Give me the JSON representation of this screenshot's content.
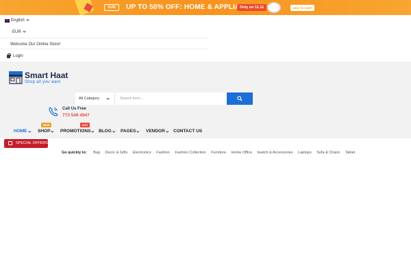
{
  "promo": {
    "logo_badge": "OUR",
    "headline": "UP TO 50% OFF: HOME & APPLIANCES",
    "badge": "Only on 11.11",
    "cta": "ADD TO CART"
  },
  "topbar": {
    "language": "English",
    "currency": "EUR",
    "welcome": "Welcome Our Online Store!",
    "login": "Login"
  },
  "brand": {
    "name": "Smart Haat",
    "tagline": "Shop all you want"
  },
  "search": {
    "category": "All Category",
    "placeholder": "Search item..."
  },
  "contact": {
    "label": "Call Us Free",
    "number": "773 549 4947"
  },
  "nav": {
    "items": [
      {
        "label": "HOME",
        "active": true
      },
      {
        "label": "SHOP",
        "flag": "NEW"
      },
      {
        "label": "PROMOTIONS",
        "flag": "HOT"
      },
      {
        "label": "BLOG"
      },
      {
        "label": "PAGES"
      },
      {
        "label": "VENDOR"
      },
      {
        "label": "CONTACT US"
      }
    ]
  },
  "special_offers": "SPECIAL OFFERS",
  "quick": {
    "label": "Go quickly to:",
    "links": [
      "Bag",
      "Decor & Gifts",
      "Electronics",
      "Fashion",
      "Fashion Collection",
      "Furniture",
      "Home Office",
      "Iwatch & Accessories",
      "Laptops",
      "Sofa & Chairs",
      "Tablet"
    ]
  },
  "colors": {
    "accent": "#1c6fd6",
    "promo": "#f7931e",
    "special": "#c41e2a",
    "hot": "#e74c3c"
  }
}
